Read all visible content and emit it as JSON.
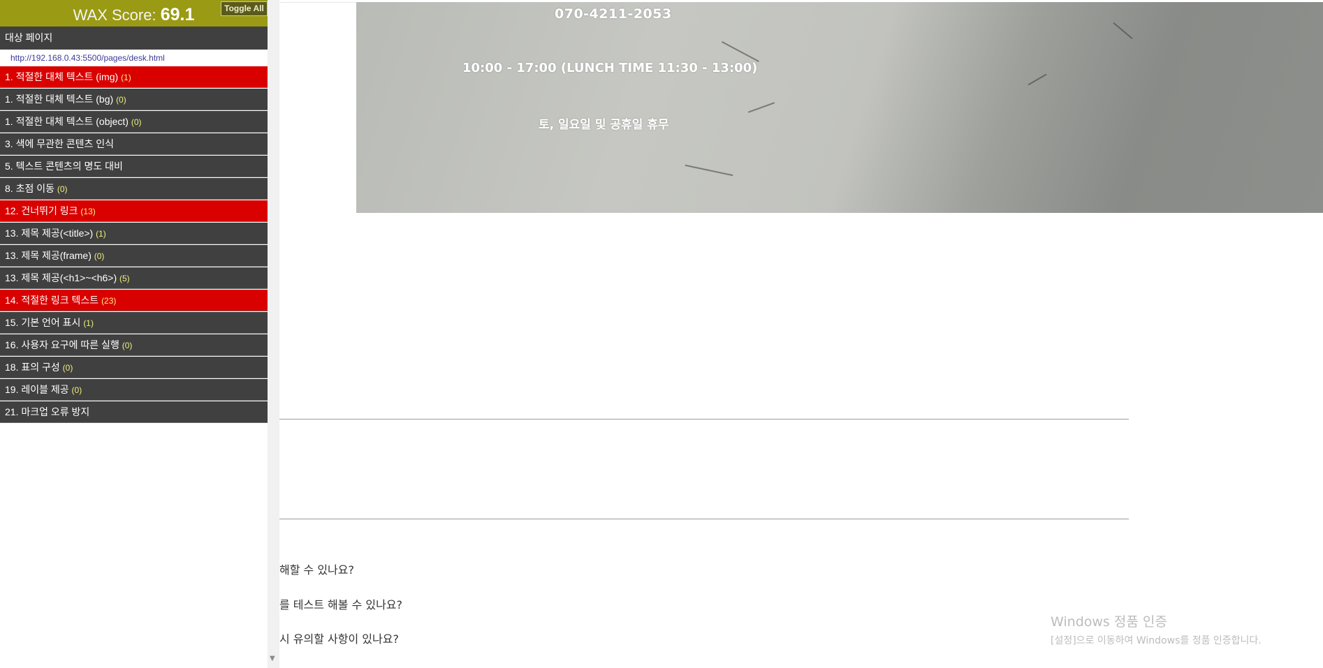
{
  "wax": {
    "score_label": "WAX Score:",
    "score_value": "69.1",
    "toggle_all": "Toggle All",
    "target_label": "대상 페이지",
    "target_url": "http://192.168.0.43:5500/pages/desk.html",
    "items": [
      {
        "label": "1. 적절한 대체 텍스트 (img)",
        "count": "(1)",
        "status": "fail"
      },
      {
        "label": "1. 적절한 대체 텍스트 (bg)",
        "count": "(0)",
        "status": "ok"
      },
      {
        "label": "1. 적절한 대체 텍스트 (object)",
        "count": "(0)",
        "status": "ok"
      },
      {
        "label": "3. 색에 무관한 콘텐츠 인식",
        "count": "",
        "status": "ok"
      },
      {
        "label": "5. 텍스트 콘텐츠의 명도 대비",
        "count": "",
        "status": "ok"
      },
      {
        "label": "8. 초점 이동",
        "count": "(0)",
        "status": "ok"
      },
      {
        "label": "12. 건너뛰기 링크",
        "count": "(13)",
        "status": "fail"
      },
      {
        "label": "13. 제목 제공(<title>)",
        "count": "(1)",
        "status": "ok"
      },
      {
        "label": "13. 제목 제공(frame)",
        "count": "(0)",
        "status": "ok"
      },
      {
        "label": "13. 제목 제공(<h1>~<h6>)",
        "count": "(5)",
        "status": "ok"
      },
      {
        "label": "14. 적절한 링크 텍스트",
        "count": "(23)",
        "status": "fail"
      },
      {
        "label": "15. 기본 언어 표시",
        "count": "(1)",
        "status": "ok"
      },
      {
        "label": "16. 사용자 요구에 따른 실행",
        "count": "(0)",
        "status": "ok"
      },
      {
        "label": "18. 표의 구성",
        "count": "(0)",
        "status": "ok"
      },
      {
        "label": "19. 레이블 제공",
        "count": "(0)",
        "status": "ok"
      },
      {
        "label": "21. 마크업 오류 방지",
        "count": "",
        "status": "ok"
      }
    ]
  },
  "hero": {
    "phone": "070-4211-2053",
    "hours": "10:00 - 17:00 (LUNCH TIME 11:30 - 13:00)",
    "closed": "토, 일요일 및 공휴일 휴무"
  },
  "faq": [
    "해할 수 있나요?",
    "를 테스트 해볼 수 있나요?",
    "시 유의할 사항이 있나요?"
  ],
  "windows": {
    "title": "Windows 정품 인증",
    "subtitle": "[설정]으로 이동하여 Windows를 정품 인증합니다."
  },
  "colors": {
    "wax_header": "#9a9a14",
    "row_ok": "#404040",
    "row_fail": "#d90000",
    "count_text": "#f1f17a"
  }
}
